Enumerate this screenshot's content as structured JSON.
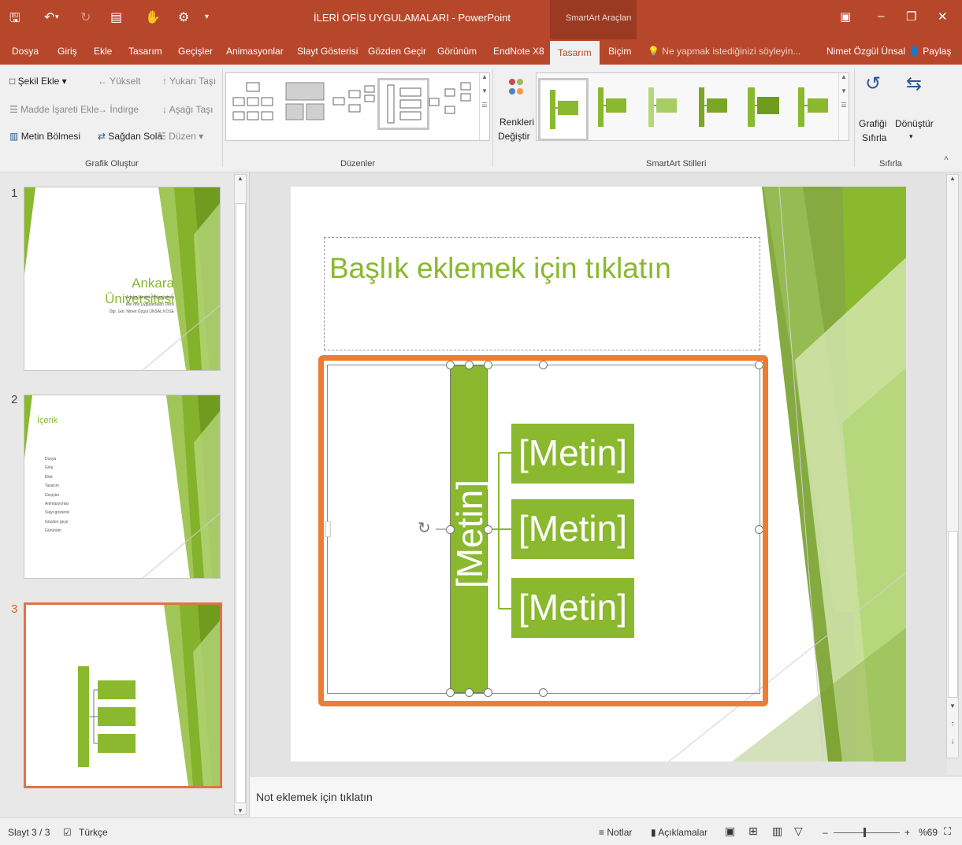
{
  "window": {
    "title": "İLERİ OFİS UYGULAMALARI - PowerPoint",
    "context_tab_group": "SmartArt Araçları"
  },
  "tabs": [
    {
      "label": "Dosya"
    },
    {
      "label": "Giriş"
    },
    {
      "label": "Ekle"
    },
    {
      "label": "Tasarım"
    },
    {
      "label": "Geçişler"
    },
    {
      "label": "Animasyonlar"
    },
    {
      "label": "Slayt Gösterisi"
    },
    {
      "label": "Gözden Geçir"
    },
    {
      "label": "Görünüm"
    },
    {
      "label": "EndNote X8"
    },
    {
      "label": "Tasarım"
    },
    {
      "label": "Biçim"
    }
  ],
  "tell_me": "Ne yapmak istediğinizi söyleyin...",
  "user": {
    "name": "Nimet Özgül Ünsal",
    "share": "Paylaş"
  },
  "ribbon": {
    "create": {
      "add_shape": "Şekil Ekle",
      "add_bullet": "Madde İşareti Ekle",
      "text_pane": "Metin Bölmesi",
      "promote": "Yükselt",
      "demote": "İndirge",
      "right_to_left": "Sağdan Sola",
      "move_up": "Yukarı Taşı",
      "move_down": "Aşağı Taşı",
      "layout": "Düzen",
      "label": "Grafik Oluştur"
    },
    "layouts": {
      "label": "Düzenler"
    },
    "colors": {
      "line1": "Renkleri",
      "line2": "Değiştir"
    },
    "styles": {
      "label": "SmartArt Stilleri"
    },
    "reset": {
      "reset_line1": "Grafiği",
      "reset_line2": "Sıfırla",
      "convert": "Dönüştür",
      "label": "Sıfırla"
    }
  },
  "slides": [
    {
      "number": "1",
      "title": "Ankara Üniversitesi",
      "sub1": "Adalet Meslek Yüksekokulu",
      "sub2": "İleri ofis Uygulamaları Dersi",
      "sub3": "Öğr. Gör. Nimet Özgül ÜNSAL KÖSE"
    },
    {
      "number": "2",
      "title": "İçerik",
      "items": [
        "Dosya",
        "Giriş",
        "Ekle",
        "Tasarım",
        "Geçişler",
        "Animasyonlar",
        "Slayt gösterisi",
        "Gözden geçir",
        "Görünüm"
      ]
    },
    {
      "number": "3"
    }
  ],
  "main_slide": {
    "title_placeholder": "Başlık eklemek için tıklatın",
    "smartart": {
      "vertical": "[Metin]",
      "items": [
        "[Metin]",
        "[Metin]",
        "[Metin]"
      ]
    }
  },
  "notes_placeholder": "Not eklemek için tıklatın",
  "status": {
    "slide_indicator": "Slayt 3 / 3",
    "language": "Türkçe",
    "notes": "Notlar",
    "comments": "Açıklamalar",
    "zoom": "%69"
  },
  "colors": {
    "ribbon_accent": "#b7472a",
    "smartart_green": "#8ab82e",
    "selection_orange": "#ed7d31",
    "title_green": "#8ab82e"
  }
}
